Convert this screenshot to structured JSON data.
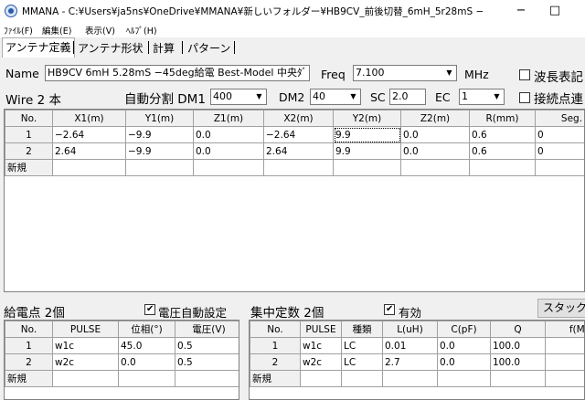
{
  "window": {
    "title": "MMANA - C:¥Users¥ja5ns¥OneDrive¥MMANA¥新しいフォルダー¥HB9CV_前後切替_6mH_5r28mS −",
    "minimize": "−",
    "maximize": "□"
  },
  "menu": [
    "ﾌｧｲﾙ(F)",
    "編集(E)",
    "表示(V)",
    "ﾍﾙﾌﾟ(H)"
  ],
  "tabs": [
    "アンテナ定義",
    "アンテナ形状",
    "計算",
    "パターン"
  ],
  "antenna": {
    "name_label": "Name",
    "name_value": "HB9CV 6mH  5.28mS −45deg給電 Best-Model 中央ﾀﾞ",
    "freq_label": "Freq",
    "freq_value": "7.100",
    "freq_unit": "MHz",
    "wavelength_label": "波長表記"
  },
  "wire": {
    "count_label": "Wire 2 本",
    "autodiv_label": "自動分割 DM1",
    "dm1_value": "400",
    "dm2_label": "DM2",
    "dm2_value": "40",
    "sc_label": "SC",
    "sc_value": "2.0",
    "ec_label": "EC",
    "ec_value": "1",
    "connect_label": "接続点連"
  },
  "wire_table": {
    "headers": [
      "No.",
      "X1(m)",
      "Y1(m)",
      "Z1(m)",
      "X2(m)",
      "Y2(m)",
      "Z2(m)",
      "R(mm)",
      "Seg."
    ],
    "rows": [
      [
        "1",
        "−2.64",
        "−9.9",
        "0.0",
        "−2.64",
        "9.9",
        "0.0",
        "0.6",
        "0"
      ],
      [
        "2",
        "2.64",
        "−9.9",
        "0.0",
        "2.64",
        "9.9",
        "0.0",
        "0.6",
        "0"
      ]
    ],
    "new_label": "新規"
  },
  "feed": {
    "title": "給電点 2個",
    "auto_voltage_label": "電圧自動設定",
    "headers": [
      "No.",
      "PULSE",
      "位相(°)",
      "電圧(V)"
    ],
    "rows": [
      [
        "1",
        "w1c",
        "45.0",
        "0.5"
      ],
      [
        "2",
        "w2c",
        "0.0",
        "0.5"
      ]
    ],
    "new_label": "新規"
  },
  "load": {
    "title": "集中定数 2個",
    "enabled_label": "有効",
    "stack_button": "スタック",
    "headers": [
      "No.",
      "PULSE",
      "種類",
      "L(uH)",
      "C(pF)",
      "Q",
      "f(MHz)"
    ],
    "rows": [
      [
        "1",
        "w1c",
        "LC",
        "0.01",
        "0.0",
        "100.0",
        ""
      ],
      [
        "2",
        "w2c",
        "LC",
        "2.7",
        "0.0",
        "100.0",
        ""
      ]
    ],
    "new_label": "新規"
  }
}
